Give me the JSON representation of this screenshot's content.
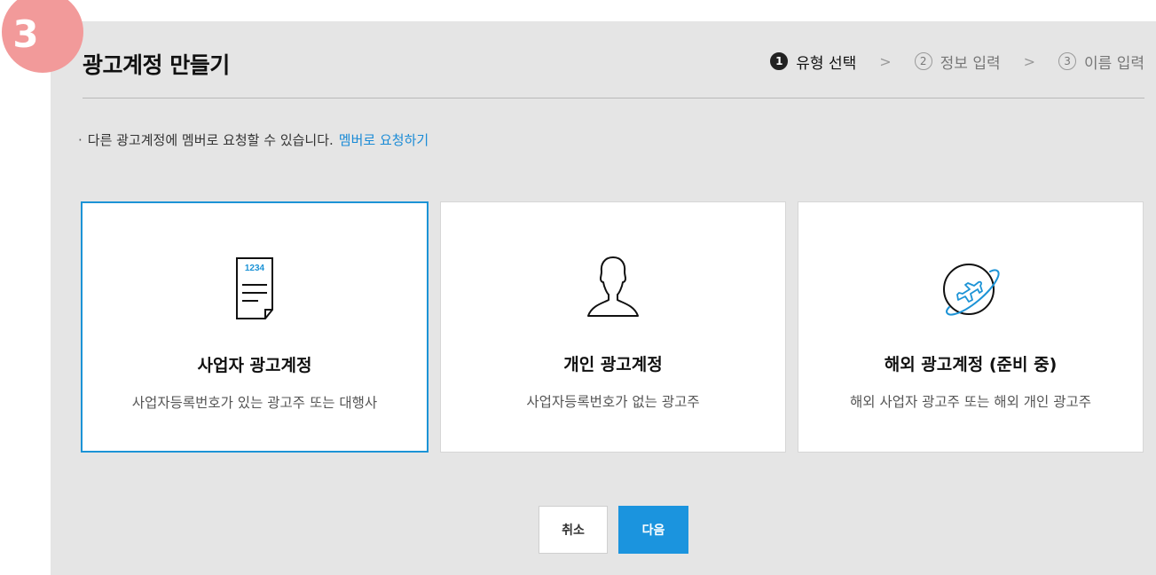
{
  "badge": {
    "number": "3"
  },
  "header": {
    "title": "광고계정 만들기"
  },
  "steps": [
    {
      "num": "1",
      "label": "유형 선택",
      "active": true
    },
    {
      "num": "2",
      "label": "정보 입력",
      "active": false
    },
    {
      "num": "3",
      "label": "이름 입력",
      "active": false
    }
  ],
  "step_separator": ">",
  "notice": {
    "bullet": "·",
    "text": "다른 광고계정에 멤버로 요청할 수 있습니다.",
    "link": "멤버로 요청하기"
  },
  "cards": [
    {
      "title": "사업자 광고계정",
      "desc": "사업자등록번호가 있는 광고주 또는 대행사",
      "icon": "business-document-icon",
      "icon_text": "1234",
      "selected": true
    },
    {
      "title": "개인 광고계정",
      "desc": "사업자등록번호가 없는 광고주",
      "icon": "person-icon",
      "selected": false
    },
    {
      "title": "해외 광고계정 (준비 중)",
      "desc": "해외 사업자 광고주 또는 해외 개인 광고주",
      "icon": "globe-airplane-icon",
      "selected": false
    }
  ],
  "buttons": {
    "cancel": "취소",
    "next": "다음"
  },
  "colors": {
    "accent": "#1b94de",
    "badge": "#f29a9a",
    "panel": "#e5e5e5"
  }
}
